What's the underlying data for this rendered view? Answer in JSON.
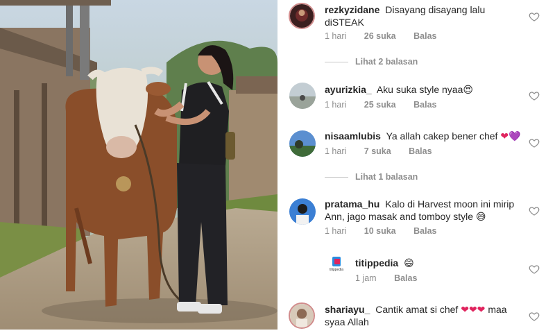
{
  "comments": [
    {
      "username": "rezkyzidane",
      "text": "Disayang disayang lalu diSTEAK",
      "time": "1 hari",
      "likes": "26 suka",
      "reply": "Balas",
      "view_replies": "Lihat 2 balasan"
    },
    {
      "username": "ayurizkia_",
      "text": "Aku suka style nyaa😍",
      "time": "1 hari",
      "likes": "25 suka",
      "reply": "Balas"
    },
    {
      "username": "nisaamlubis",
      "text": "Ya allah cakep bener chef",
      "emoji": "❤💜",
      "time": "1 hari",
      "likes": "7 suka",
      "reply": "Balas",
      "view_replies": "Lihat 1 balasan"
    },
    {
      "username": "pratama_hu",
      "text": "Kalo di Harvest moon ini mirip Ann, jago masak and tomboy style 😅",
      "time": "1 hari",
      "likes": "10 suka",
      "reply": "Balas"
    },
    {
      "username": "titippedia",
      "text": "😄",
      "time": "1 jam",
      "reply": "Balas",
      "avatar_label": "titippedia"
    },
    {
      "username": "shariayu_",
      "text": "Cantik amat si chef",
      "emoji": "❤❤❤",
      "text_after": "maa syaa Allah"
    }
  ],
  "colors": {
    "text": "#262626",
    "meta": "#8e8e8e",
    "heart_outline": "#8e8e8e"
  },
  "icons": {
    "like": "heart-outline-icon"
  }
}
